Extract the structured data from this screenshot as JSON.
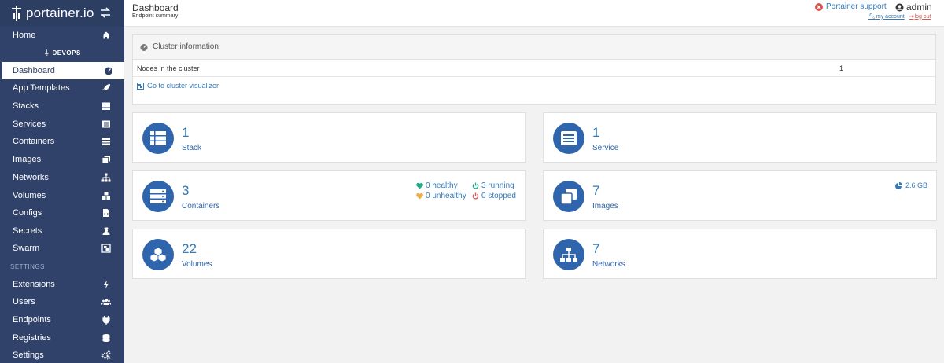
{
  "brand": {
    "name": "portainer.io"
  },
  "sidebar": {
    "home": "Home",
    "endpoint_label": "DEVOPS",
    "items": [
      {
        "label": "Dashboard",
        "icon": "tachometer-icon",
        "active": true
      },
      {
        "label": "App Templates",
        "icon": "rocket-icon"
      },
      {
        "label": "Stacks",
        "icon": "th-list-icon"
      },
      {
        "label": "Services",
        "icon": "list-alt-icon"
      },
      {
        "label": "Containers",
        "icon": "server-icon"
      },
      {
        "label": "Images",
        "icon": "clone-icon"
      },
      {
        "label": "Networks",
        "icon": "sitemap-icon"
      },
      {
        "label": "Volumes",
        "icon": "cubes-icon"
      },
      {
        "label": "Configs",
        "icon": "file-code-icon"
      },
      {
        "label": "Secrets",
        "icon": "user-secret-icon"
      },
      {
        "label": "Swarm",
        "icon": "object-group-icon"
      }
    ],
    "settings_label": "SETTINGS",
    "settings_items": [
      {
        "label": "Extensions",
        "icon": "bolt-icon"
      },
      {
        "label": "Users",
        "icon": "users-icon"
      },
      {
        "label": "Endpoints",
        "icon": "plug-icon"
      },
      {
        "label": "Registries",
        "icon": "database-icon"
      },
      {
        "label": "Settings",
        "icon": "cogs-icon"
      }
    ]
  },
  "header": {
    "title": "Dashboard",
    "subtitle": "Endpoint summary",
    "support": "Portainer support",
    "user": "admin",
    "my_account": "my account",
    "log_out": "log out"
  },
  "cluster": {
    "title": "Cluster information",
    "nodes_label": "Nodes in the cluster",
    "nodes_value": "1",
    "visualizer_link": "Go to cluster visualizer"
  },
  "widgets": {
    "stack": {
      "count": "1",
      "label": "Stack"
    },
    "service": {
      "count": "1",
      "label": "Service"
    },
    "containers": {
      "count": "3",
      "label": "Containers",
      "healthy": "0 healthy",
      "unhealthy": "0 unhealthy",
      "running": "3 running",
      "stopped": "0 stopped"
    },
    "images": {
      "count": "7",
      "label": "Images",
      "size": "2.6 GB"
    },
    "volumes": {
      "count": "22",
      "label": "Volumes"
    },
    "networks": {
      "count": "7",
      "label": "Networks"
    }
  },
  "colors": {
    "sidebar": "#30426a",
    "accent": "#2e65ad",
    "link": "#337ab7",
    "healthy": "#23ae89",
    "unhealthy": "#f0ad4e",
    "running": "#23ae89",
    "stopped": "#d9534f"
  }
}
